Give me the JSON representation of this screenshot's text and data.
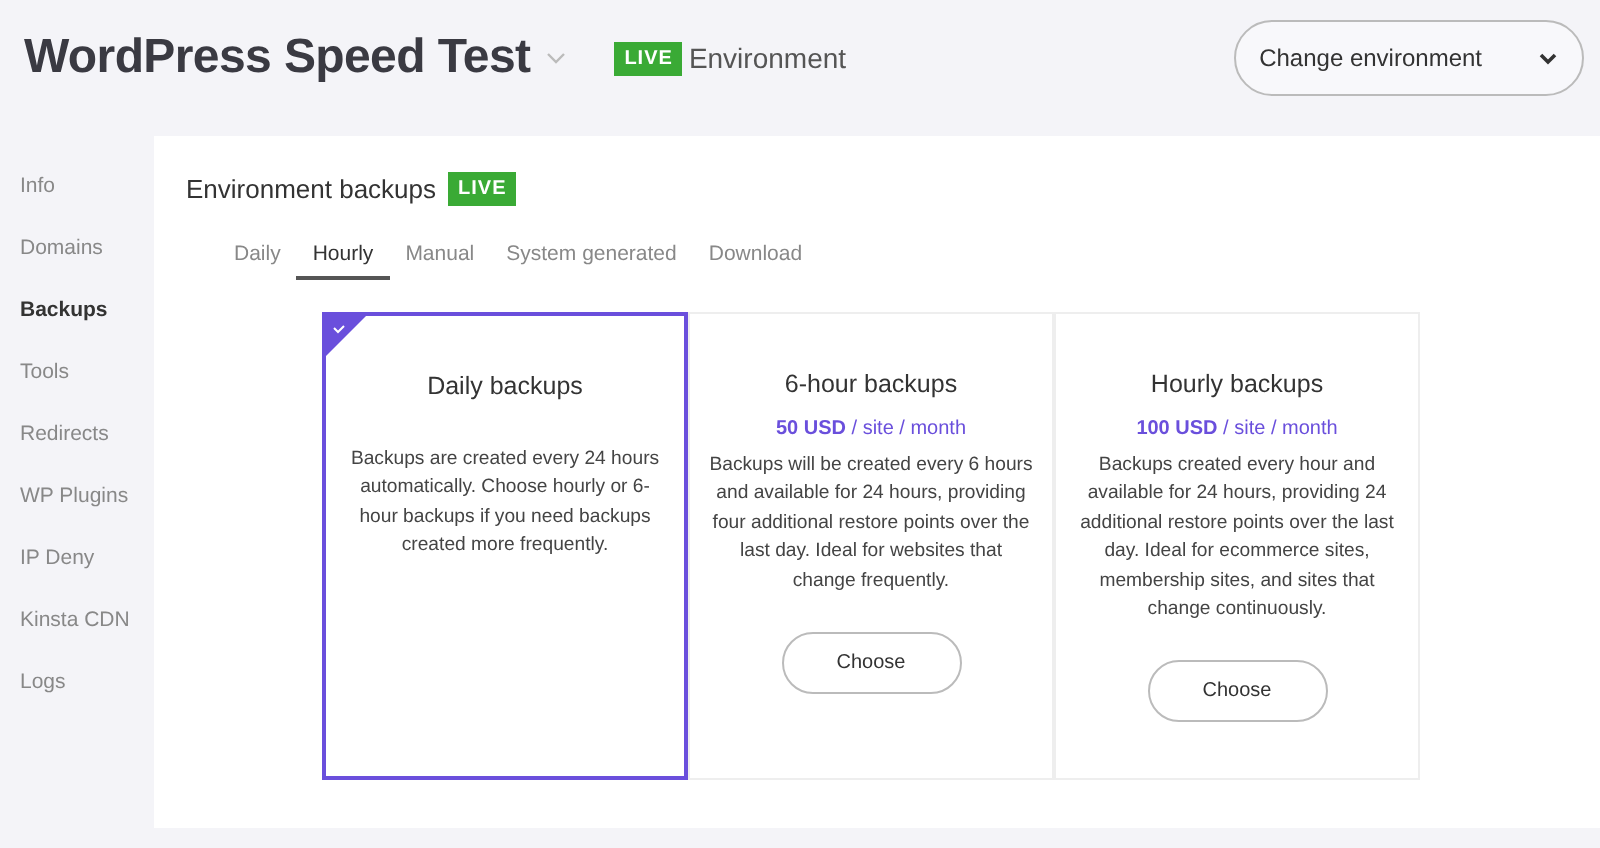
{
  "header": {
    "title": "WordPress Speed Test",
    "badge": "LIVE",
    "environment": "Environment",
    "change_button": "Change environment"
  },
  "sidebar": {
    "items": [
      {
        "label": "Info",
        "selected": false
      },
      {
        "label": "Domains",
        "selected": false
      },
      {
        "label": "Backups",
        "selected": true
      },
      {
        "label": "Tools",
        "selected": false
      },
      {
        "label": "Redirects",
        "selected": false
      },
      {
        "label": "WP Plugins",
        "selected": false
      },
      {
        "label": "IP Deny",
        "selected": false
      },
      {
        "label": "Kinsta CDN",
        "selected": false
      },
      {
        "label": "Logs",
        "selected": false
      }
    ]
  },
  "panel": {
    "title": "Environment backups",
    "badge": "LIVE",
    "tabs": [
      {
        "label": "Daily",
        "selected": false
      },
      {
        "label": "Hourly",
        "selected": true
      },
      {
        "label": "Manual",
        "selected": false
      },
      {
        "label": "System generated",
        "selected": false
      },
      {
        "label": "Download",
        "selected": false
      }
    ],
    "plans": [
      {
        "title": "Daily backups",
        "selected": true,
        "description": "Backups are created every 24 hours automatically. Choose hourly or 6-hour backups if you need backups created more frequently."
      },
      {
        "title": "6-hour backups",
        "selected": false,
        "price": "**50 USD** / site / month",
        "description": "Backups will be created every 6 hours and available for 24 hours, providing four additional restore points over the last day. Ideal for websites that change frequently.",
        "button": "Choose"
      },
      {
        "title": "Hourly backups",
        "selected": false,
        "price": "**100 USD** / site / month",
        "description": "Backups created every hour and available for 24 hours, providing 24 additional restore points over the last day. Ideal for ecommerce sites, membership sites, and sites that change continuously.",
        "button": "Choose"
      }
    ]
  }
}
